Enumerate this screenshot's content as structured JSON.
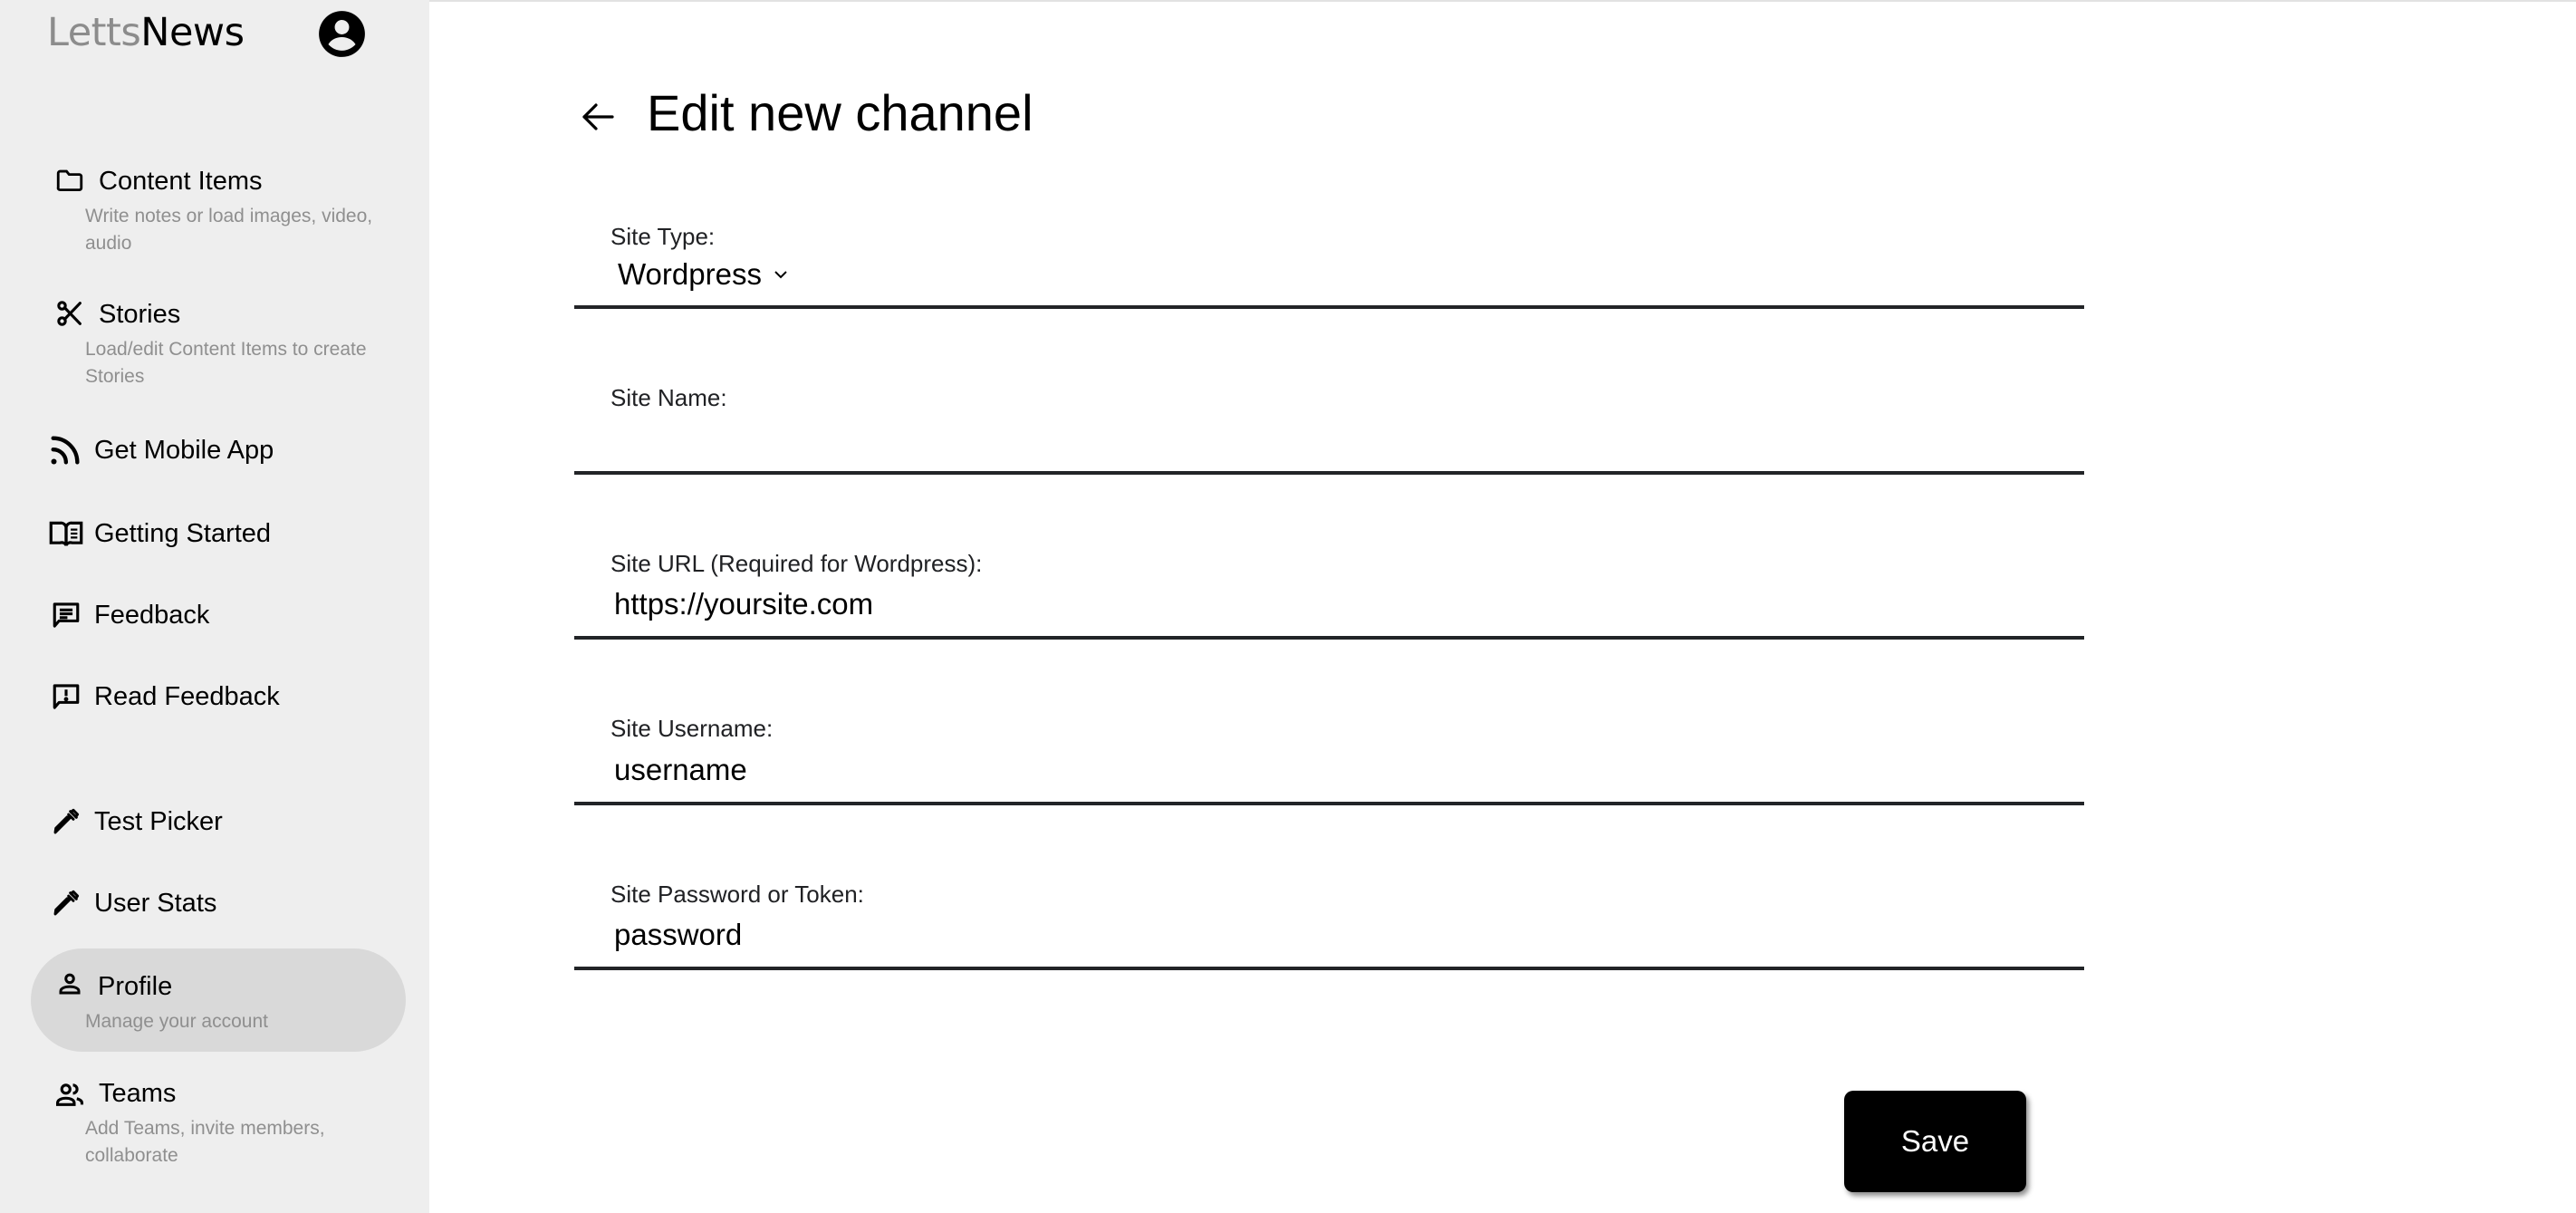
{
  "app": {
    "logo_part1": "Letts",
    "logo_part2": "News",
    "account_icon": "account-circle-icon"
  },
  "sidebar": {
    "items": [
      {
        "label": "Content Items",
        "description": "Write notes or load images, video, audio",
        "icon": "folder-icon",
        "active": false
      },
      {
        "label": "Stories",
        "description": "Load/edit Content Items to create Stories",
        "icon": "scissors-icon",
        "active": false
      },
      {
        "label": "Get Mobile App",
        "description": "",
        "icon": "rss-feed-icon",
        "active": false
      },
      {
        "label": "Getting Started",
        "description": "",
        "icon": "open-book-icon",
        "active": false
      },
      {
        "label": "Feedback",
        "description": "",
        "icon": "chat-text-icon",
        "active": false
      },
      {
        "label": "Read Feedback",
        "description": "",
        "icon": "chat-alert-icon",
        "active": false
      },
      {
        "label": "Test Picker",
        "description": "",
        "icon": "eyedropper-icon",
        "active": false
      },
      {
        "label": "User Stats",
        "description": "",
        "icon": "eyedropper-icon",
        "active": false
      },
      {
        "label": "Profile",
        "description": "Manage your account",
        "icon": "person-icon",
        "active": true
      },
      {
        "label": "Teams",
        "description": "Add Teams, invite members, collaborate",
        "icon": "people-icon",
        "active": false
      }
    ]
  },
  "main": {
    "back_icon": "arrow-left-icon",
    "title": "Edit new channel",
    "form": {
      "site_type": {
        "label": "Site Type:",
        "value": "Wordpress"
      },
      "site_name": {
        "label": "Site Name:",
        "value": ""
      },
      "site_url": {
        "label": "Site URL (Required for Wordpress):",
        "value": "https://yoursite.com"
      },
      "site_username": {
        "label": "Site Username:",
        "value": "username"
      },
      "site_password": {
        "label": "Site Password or Token:",
        "value": "password"
      }
    },
    "save_label": "Save"
  },
  "colors": {
    "sidebar_bg": "#eeeeee",
    "active_item_bg": "#d9d9d9",
    "logo_gray": "#8c8c8c",
    "description_gray": "#8f8f8f",
    "button_bg": "#000000",
    "button_text": "#ffffff"
  }
}
